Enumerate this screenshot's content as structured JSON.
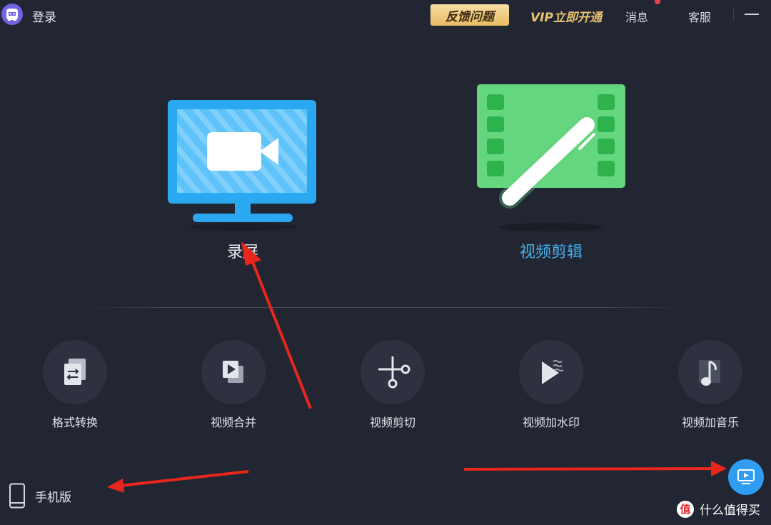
{
  "titlebar": {
    "login_label": "登录",
    "feedback_label": "反馈问题",
    "vip_label": "VIP立即开通",
    "messages_label": "消息",
    "support_label": "客服"
  },
  "main_features": [
    {
      "label": "录屏",
      "icon": "screen-record-icon"
    },
    {
      "label": "视频剪辑",
      "icon": "video-edit-icon"
    }
  ],
  "tools": [
    {
      "label": "格式转换",
      "icon": "format-convert-icon"
    },
    {
      "label": "视频合并",
      "icon": "video-merge-icon"
    },
    {
      "label": "视频剪切",
      "icon": "scissors-icon"
    },
    {
      "label": "视频加水印",
      "icon": "watermark-icon"
    },
    {
      "label": "视频加音乐",
      "icon": "music-note-icon"
    }
  ],
  "footer": {
    "mobile_label": "手机版",
    "watermark_badge": "值",
    "watermark_text": "什么值得买"
  },
  "colors": {
    "background": "#222633",
    "accent_blue": "#45b0ef",
    "accent_green": "#64d67f",
    "vip_gold": "#e8c36e",
    "arrow_red": "#e8261c"
  }
}
